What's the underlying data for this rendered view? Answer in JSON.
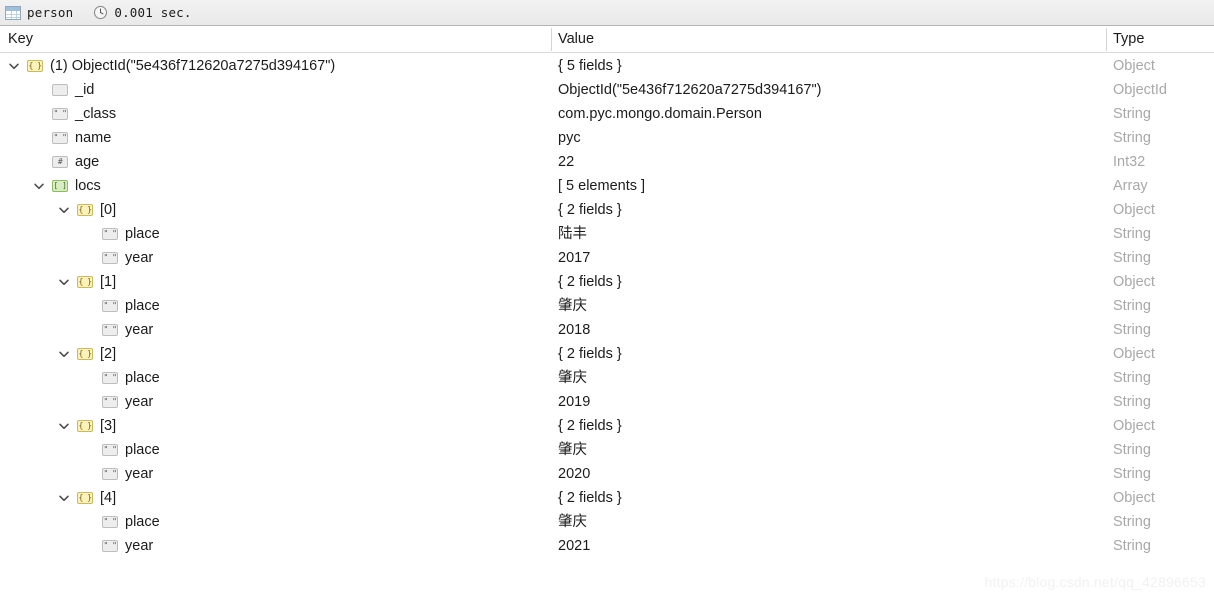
{
  "toolbar": {
    "collection_icon": "grid-icon",
    "collection_name": "person",
    "timer_icon": "clock-icon",
    "elapsed": "0.001 sec."
  },
  "columns": {
    "key": "Key",
    "value": "Value",
    "type": "Type"
  },
  "rows": [
    {
      "indent": 0,
      "twisty": "down",
      "icon": "obj",
      "glyph": "{ }",
      "key": "(1) ObjectId(\"5e436f712620a7275d394167\")",
      "value": "{ 5 fields }",
      "type": "Object"
    },
    {
      "indent": 1,
      "twisty": "none",
      "icon": "oid",
      "glyph": "",
      "key": "_id",
      "value": "ObjectId(\"5e436f712620a7275d394167\")",
      "type": "ObjectId"
    },
    {
      "indent": 1,
      "twisty": "none",
      "icon": "str",
      "glyph": "\" \"",
      "key": "_class",
      "value": "com.pyc.mongo.domain.Person",
      "type": "String"
    },
    {
      "indent": 1,
      "twisty": "none",
      "icon": "str",
      "glyph": "\" \"",
      "key": "name",
      "value": "pyc",
      "type": "String"
    },
    {
      "indent": 1,
      "twisty": "none",
      "icon": "num",
      "glyph": "#",
      "key": "age",
      "value": "22",
      "type": "Int32"
    },
    {
      "indent": 1,
      "twisty": "down",
      "icon": "arr",
      "glyph": "[ ]",
      "key": "locs",
      "value": "[ 5 elements ]",
      "type": "Array"
    },
    {
      "indent": 2,
      "twisty": "down",
      "icon": "obj",
      "glyph": "{ }",
      "key": "[0]",
      "value": "{ 2 fields }",
      "type": "Object"
    },
    {
      "indent": 3,
      "twisty": "none",
      "icon": "str",
      "glyph": "\" \"",
      "key": "place",
      "value": "陆丰",
      "type": "String"
    },
    {
      "indent": 3,
      "twisty": "none",
      "icon": "str",
      "glyph": "\" \"",
      "key": "year",
      "value": "2017",
      "type": "String"
    },
    {
      "indent": 2,
      "twisty": "down",
      "icon": "obj",
      "glyph": "{ }",
      "key": "[1]",
      "value": "{ 2 fields }",
      "type": "Object"
    },
    {
      "indent": 3,
      "twisty": "none",
      "icon": "str",
      "glyph": "\" \"",
      "key": "place",
      "value": "肇庆",
      "type": "String"
    },
    {
      "indent": 3,
      "twisty": "none",
      "icon": "str",
      "glyph": "\" \"",
      "key": "year",
      "value": "2018",
      "type": "String"
    },
    {
      "indent": 2,
      "twisty": "down",
      "icon": "obj",
      "glyph": "{ }",
      "key": "[2]",
      "value": "{ 2 fields }",
      "type": "Object"
    },
    {
      "indent": 3,
      "twisty": "none",
      "icon": "str",
      "glyph": "\" \"",
      "key": "place",
      "value": "肇庆",
      "type": "String"
    },
    {
      "indent": 3,
      "twisty": "none",
      "icon": "str",
      "glyph": "\" \"",
      "key": "year",
      "value": "2019",
      "type": "String"
    },
    {
      "indent": 2,
      "twisty": "down",
      "icon": "obj",
      "glyph": "{ }",
      "key": "[3]",
      "value": "{ 2 fields }",
      "type": "Object"
    },
    {
      "indent": 3,
      "twisty": "none",
      "icon": "str",
      "glyph": "\" \"",
      "key": "place",
      "value": "肇庆",
      "type": "String"
    },
    {
      "indent": 3,
      "twisty": "none",
      "icon": "str",
      "glyph": "\" \"",
      "key": "year",
      "value": "2020",
      "type": "String"
    },
    {
      "indent": 2,
      "twisty": "down",
      "icon": "obj",
      "glyph": "{ }",
      "key": "[4]",
      "value": "{ 2 fields }",
      "type": "Object"
    },
    {
      "indent": 3,
      "twisty": "none",
      "icon": "str",
      "glyph": "\" \"",
      "key": "place",
      "value": "肇庆",
      "type": "String"
    },
    {
      "indent": 3,
      "twisty": "none",
      "icon": "str",
      "glyph": "\" \"",
      "key": "year",
      "value": "2021",
      "type": "String"
    }
  ],
  "watermark": "https://blog.csdn.net/qq_42896653",
  "colors": {
    "object_icon": "#fdf3b8",
    "array_icon": "#d8eec1",
    "scalar_icon": "#ededed",
    "type_text": "#a8a8a8",
    "toolbar_bg": "#eeeeee"
  }
}
